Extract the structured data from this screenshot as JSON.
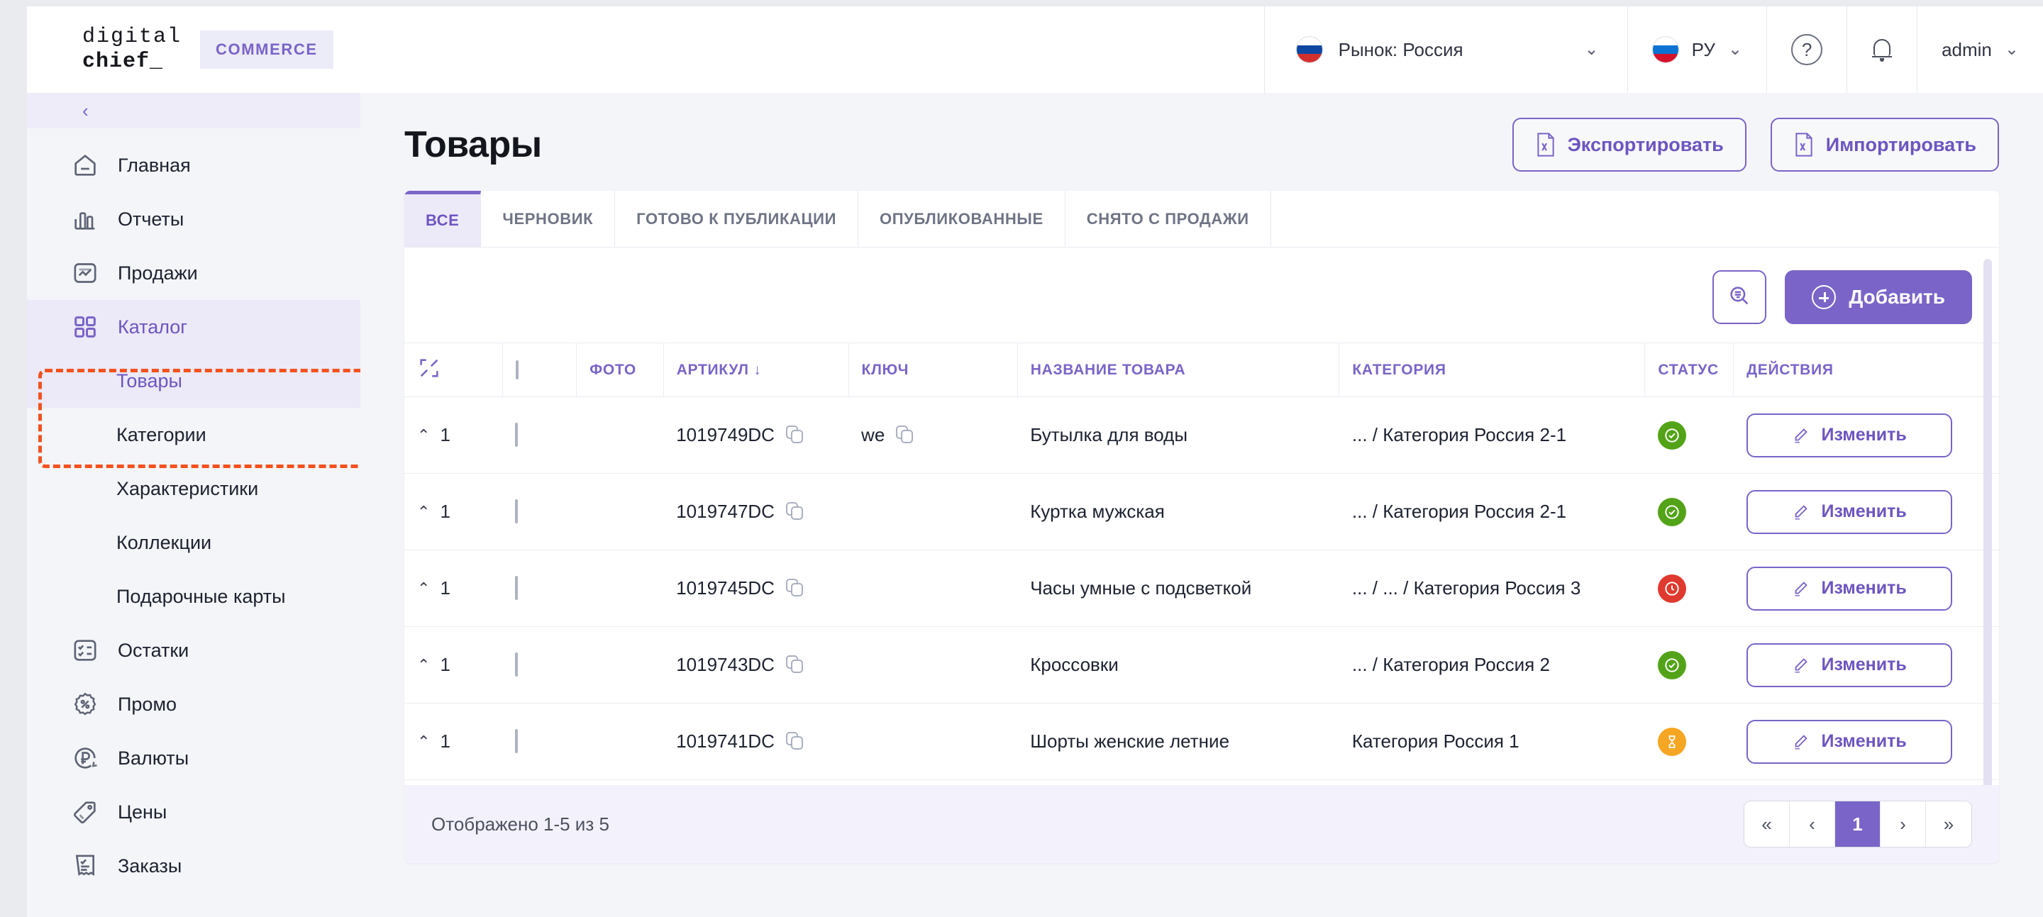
{
  "header": {
    "logo_line1": "digital",
    "logo_line2": "chief_",
    "badge": "COMMERCE",
    "market_label": "Рынок: Россия",
    "market_chevron": "⌄",
    "lang_label": "РУ",
    "lang_chevron": "⌄",
    "help_glyph": "?",
    "help_icon": "question-circle-icon",
    "bell_icon": "bell-icon",
    "user_label": "admin",
    "user_chevron": "⌄"
  },
  "sidebar": {
    "collapse_glyph": "‹",
    "items": [
      {
        "label": "Главная",
        "icon": "home-icon",
        "level": "top",
        "state": "normal"
      },
      {
        "label": "Отчеты",
        "icon": "bar-chart-icon",
        "level": "top",
        "state": "normal"
      },
      {
        "label": "Продажи",
        "icon": "trend-box-icon",
        "level": "top",
        "state": "normal"
      },
      {
        "label": "Каталог",
        "icon": "grid-icon",
        "level": "top",
        "state": "active"
      },
      {
        "label": "Товары",
        "icon": "none",
        "level": "sub",
        "state": "active"
      },
      {
        "label": "Категории",
        "icon": "none",
        "level": "sub",
        "state": "normal"
      },
      {
        "label": "Характеристики",
        "icon": "none",
        "level": "sub",
        "state": "normal"
      },
      {
        "label": "Коллекции",
        "icon": "none",
        "level": "sub",
        "state": "normal"
      },
      {
        "label": "Подарочные карты",
        "icon": "none",
        "level": "sub",
        "state": "normal"
      },
      {
        "label": "Остатки",
        "icon": "checklist-icon",
        "level": "top",
        "state": "normal"
      },
      {
        "label": "Промо",
        "icon": "percent-icon",
        "level": "top",
        "state": "normal"
      },
      {
        "label": "Валюты",
        "icon": "ruble-icon",
        "level": "top",
        "state": "normal"
      },
      {
        "label": "Цены",
        "icon": "price-tag-icon",
        "level": "top",
        "state": "normal"
      },
      {
        "label": "Заказы",
        "icon": "receipt-icon",
        "level": "top",
        "state": "normal"
      }
    ]
  },
  "page": {
    "title": "Товары",
    "export_label": "Экспортировать",
    "import_label": "Импортировать",
    "export_icon": "excel-file-icon",
    "import_icon": "excel-file-icon"
  },
  "tabs": [
    {
      "label": "ВСЕ",
      "active": true
    },
    {
      "label": "ЧЕРНОВИК",
      "active": false
    },
    {
      "label": "ГОТОВО К ПУБЛИКАЦИИ",
      "active": false
    },
    {
      "label": "ОПУБЛИКОВАННЫЕ",
      "active": false
    },
    {
      "label": "СНЯТО С ПРОДАЖИ",
      "active": false
    }
  ],
  "toolbar": {
    "search_icon": "search-filter-icon",
    "add_label": "Добавить",
    "add_icon": "plus-circle-icon"
  },
  "table": {
    "collapse_icon": "collapse-arrows-icon",
    "columns": {
      "photo": "ФОТО",
      "article": "АРТИКУЛ",
      "article_sort": "↓",
      "key": "КЛЮЧ",
      "name": "НАЗВАНИЕ ТОВАРА",
      "category": "КАТЕГОРИЯ",
      "status": "СТАТУС",
      "actions": "ДЕЙСТВИЯ"
    },
    "edit_label": "Изменить",
    "edit_icon": "pencil-icon",
    "copy_icon": "copy-icon",
    "rows": [
      {
        "expand": "⌃",
        "count": "1",
        "article": "1019749DC",
        "key": "we",
        "name": "Бутылка для воды",
        "category": "... / Категория Россия 2-1",
        "status": "published",
        "status_icon": "check-circle-icon",
        "photo_alt": "water-bottle-photo",
        "photo_c1": "#d8cdc6",
        "photo_c2": "#e8b3ad",
        "photo_c3": "#a9d4a7"
      },
      {
        "expand": "⌃",
        "count": "1",
        "article": "1019747DC",
        "key": "",
        "name": "Куртка мужская",
        "category": "... / Категория Россия 2-1",
        "status": "published",
        "status_icon": "check-circle-icon",
        "photo_alt": "mens-jacket-photo",
        "photo_c1": "#3a3f46",
        "photo_c2": "#1b1d22",
        "photo_c3": "#6c717a"
      },
      {
        "expand": "⌃",
        "count": "1",
        "article": "1019745DC",
        "key": "",
        "name": "Часы умные с подсветкой",
        "category": "... / ... / Категория Россия 3",
        "status": "pending",
        "status_icon": "clock-circle-icon",
        "photo_alt": "smart-watch-photo",
        "photo_c1": "#e8d6cc",
        "photo_c2": "#2c2c30",
        "photo_c3": "#d8bfb2"
      },
      {
        "expand": "⌃",
        "count": "1",
        "article": "1019743DC",
        "key": "",
        "name": "Кроссовки",
        "category": "... / Категория Россия 2",
        "status": "published",
        "status_icon": "check-circle-icon",
        "photo_alt": "sneakers-photo",
        "photo_c1": "#f0ece8",
        "photo_c2": "#ffffff",
        "photo_c3": "#ddd6cf"
      },
      {
        "expand": "⌃",
        "count": "1",
        "article": "1019741DC",
        "key": "",
        "name": "Шорты женские летние",
        "category": "Категория Россия 1",
        "status": "draft",
        "status_icon": "hourglass-icon",
        "photo_alt": "denim-shorts-photo",
        "photo_c1": "#efe6e0",
        "photo_c2": "#6d8db5",
        "photo_c3": "#c7b9ae"
      }
    ]
  },
  "footer": {
    "shown_text": "Отображено 1-5 из 5",
    "pager": {
      "first": "«",
      "prev": "‹",
      "current": "1",
      "next": "›",
      "last": "»"
    }
  },
  "colors": {
    "accent_purple": "#7a64c8",
    "accent_purple_dark": "#6d55c0",
    "accent_soft": "#ece9f9",
    "annotation_orange": "#f4511e",
    "status_green": "#53a318",
    "status_red": "#e03a2f",
    "status_orange": "#f5a623"
  }
}
